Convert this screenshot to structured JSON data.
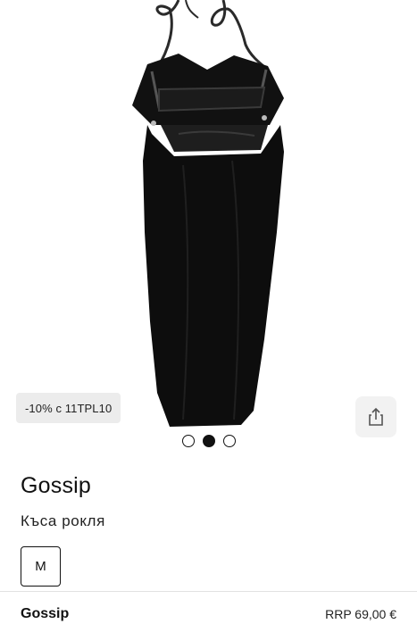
{
  "product": {
    "promo_badge": "-10% с 11TPL10",
    "brand": "Gossip",
    "type": "Къса рокля",
    "size": "M"
  },
  "gallery": {
    "image_count": 3,
    "active_index": 1
  },
  "sticky_bar": {
    "brand": "Gossip",
    "price": "RRP 69,00 €"
  },
  "icons": {
    "share": "share-icon"
  }
}
